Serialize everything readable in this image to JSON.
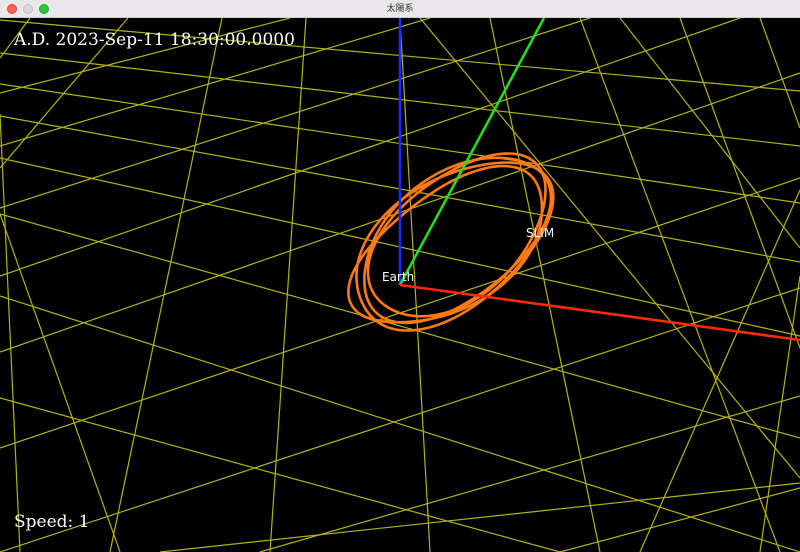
{
  "window": {
    "title": "太陽系"
  },
  "hud": {
    "date": "A.D. 2023-Sep-11 18:30:00.0000",
    "speed": "Speed: 1"
  },
  "bodies": {
    "earth": "Earth",
    "slim": "SLIM"
  },
  "colors": {
    "grid": "#b3b313",
    "x_axis": "#ff2a00",
    "y_axis": "#22dd22",
    "z_axis": "#1a2cff",
    "orbit": "#ff7a14"
  }
}
